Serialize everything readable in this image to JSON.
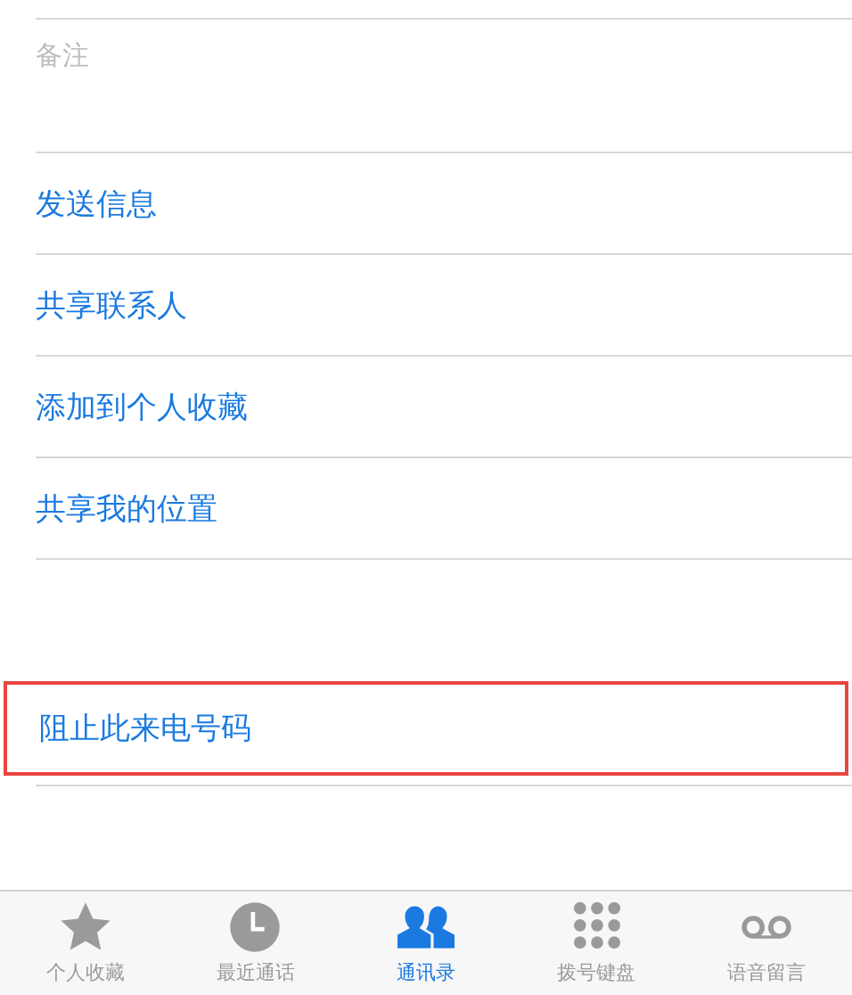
{
  "notes": {
    "label": "备注"
  },
  "actions": [
    {
      "label": "发送信息",
      "highlighted": false
    },
    {
      "label": "共享联系人",
      "highlighted": false
    },
    {
      "label": "添加到个人收藏",
      "highlighted": false
    },
    {
      "label": "共享我的位置",
      "highlighted": false
    }
  ],
  "block_action": {
    "label": "阻止此来电号码",
    "highlighted": true
  },
  "tab_bar": [
    {
      "label": "个人收藏",
      "selected": false
    },
    {
      "label": "最近通话",
      "selected": false
    },
    {
      "label": "通讯录",
      "selected": true
    },
    {
      "label": "拨号键盘",
      "selected": false
    },
    {
      "label": "语音留言",
      "selected": false
    }
  ]
}
